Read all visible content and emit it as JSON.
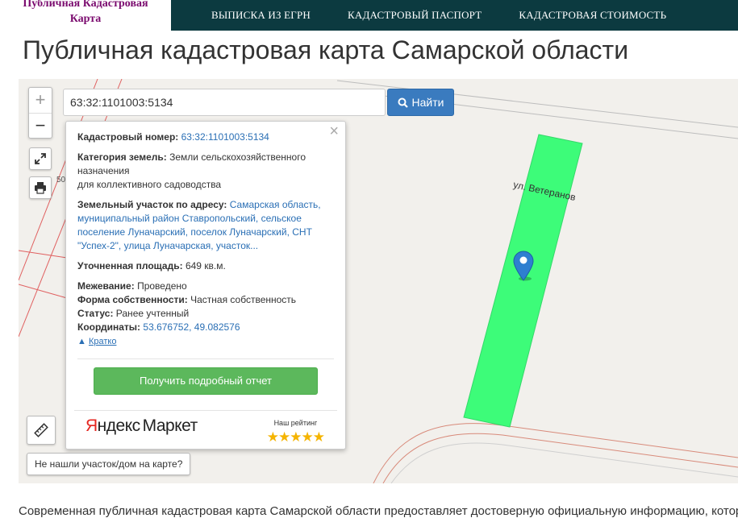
{
  "header": {
    "logo_line1": "Публичная Кадастровая",
    "logo_line2": "Карта",
    "nav": [
      "ВЫПИСКА ИЗ ЕГРН",
      "КАДАСТРОВЫЙ ПАСПОРТ",
      "КАДАСТРОВАЯ СТОИМОСТЬ"
    ]
  },
  "page_title": "Публичная кадастровая карта Самарской области",
  "map": {
    "search_value": "63:32:1101003:5134",
    "search_button": "Найти",
    "zoom_in": "+",
    "zoom_out": "−",
    "street_label": "ул. Ветеранов",
    "side_label": "50",
    "parcel_color": "#3dfc79",
    "not_found": "Не нашли участок/дом на карте?"
  },
  "popup": {
    "cadastral_label": "Кадастровый номер:",
    "cadastral_value": "63:32:1101003:5134",
    "category_label": "Категория земель:",
    "category_value": "Земли сельскохозяйственного назначения",
    "category_value2": "для коллективного садоводства",
    "address_label": "Земельный участок по адресу:",
    "address_value": "Самарская область, муниципальный район Ставропольский, сельское поселение Луначарский, поселок Луначарский, СНТ \"Успех-2\", улица Луначарская, участок...",
    "area_label": "Уточненная площадь:",
    "area_value": "649 кв.м.",
    "survey_label": "Межевание:",
    "survey_value": "Проведено",
    "ownership_label": "Форма собственности:",
    "ownership_value": "Частная собственность",
    "status_label": "Статус:",
    "status_value": "Ранее учтенный",
    "coords_label": "Координаты:",
    "coords_value": "53.676752, 49.082576",
    "brief_link": "Кратко",
    "report_button": "Получить подробный отчет",
    "ym_logo_red": "Я",
    "ym_logo_rest": "ндекс",
    "ym_logo_market": "Маркет",
    "rating_label": "Наш рейтинг",
    "rating_stars": "★★★★★"
  },
  "bottom_text": "Современная публичная кадастровая карта Самарской области предоставляет достоверную официальную информацию, которая ка"
}
